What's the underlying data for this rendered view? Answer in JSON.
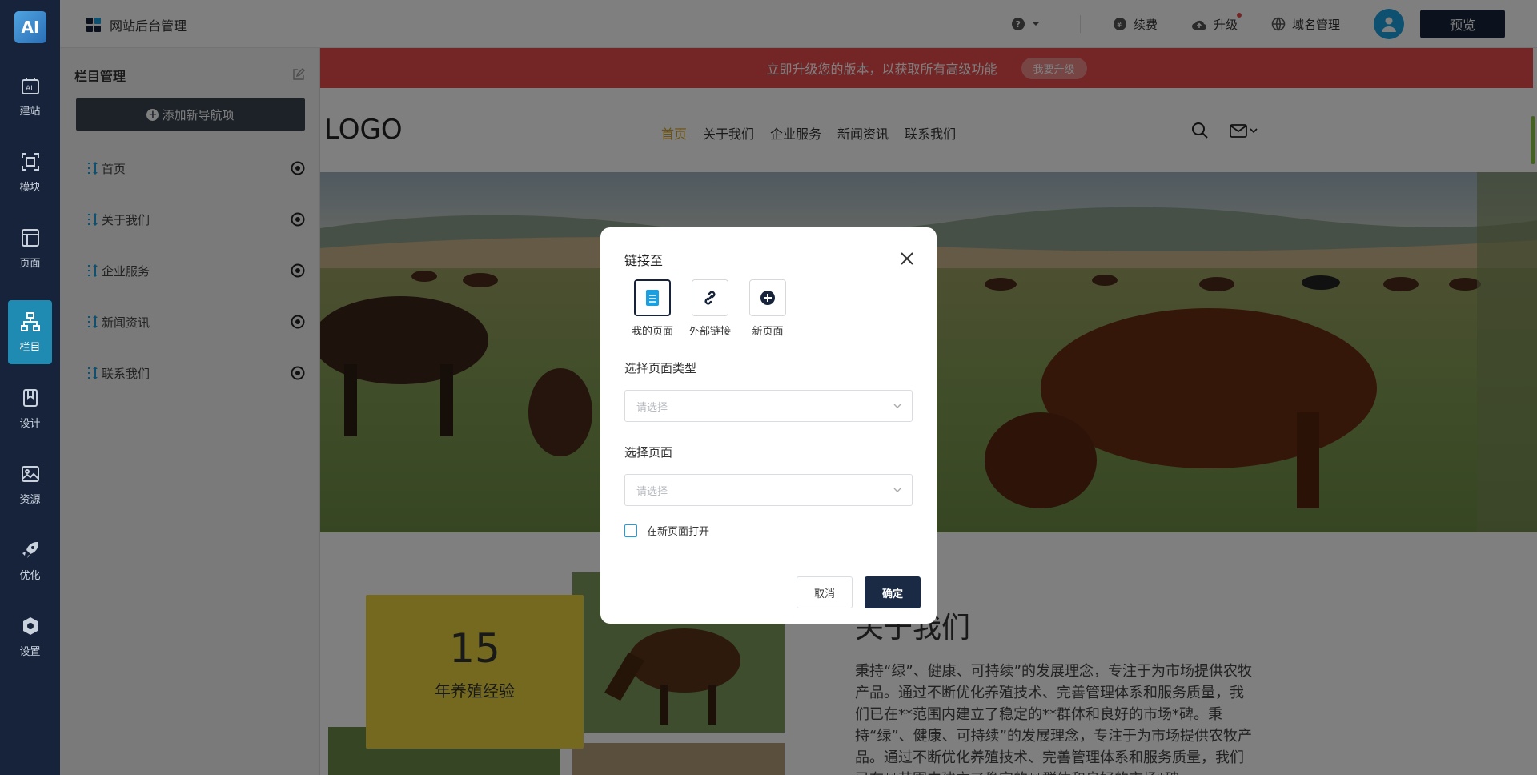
{
  "rail": {
    "logo": "AI",
    "items": [
      {
        "label": "建站",
        "icon": "ai-build-icon"
      },
      {
        "label": "模块",
        "icon": "module-icon"
      },
      {
        "label": "页面",
        "icon": "page-icon"
      },
      {
        "label": "栏目",
        "icon": "sitemap-icon"
      },
      {
        "label": "设计",
        "icon": "design-icon"
      },
      {
        "label": "资源",
        "icon": "image-icon"
      },
      {
        "label": "优化",
        "icon": "rocket-icon"
      },
      {
        "label": "设置",
        "icon": "gear-icon"
      }
    ],
    "active_index": 3
  },
  "header": {
    "title": "网站后台管理",
    "renew": "续费",
    "upgrade": "升级",
    "domain": "域名管理",
    "preview": "预览"
  },
  "panel": {
    "title": "栏目管理",
    "add_button": "添加新导航项",
    "items": [
      "首页",
      "关于我们",
      "企业服务",
      "新闻资讯",
      "联系我们"
    ]
  },
  "site": {
    "promo_text": "立即升级您的版本，以获取所有高级功能",
    "promo_button": "我要升级",
    "logo": "LOGO",
    "nav": [
      "首页",
      "关于我们",
      "企业服务",
      "新闻资讯",
      "联系我们"
    ],
    "stat_number": "15",
    "stat_label": "年养殖经验",
    "about_title": "关于我们",
    "about_text": "秉持“绿”、健康、可持续”的发展理念，专注于为市场提供农牧产品。通过不断优化养殖技术、完善管理体系和服务质量，我们已在**范围内建立了稳定的**群体和良好的市场*碑。秉持“绿”、健康、可持续”的发展理念，专注于为市场提供农牧产品。通过不断优化养殖技术、完善管理体系和服务质量，我们已在**范围内建立了稳定的**群体和良好的市场*碑。"
  },
  "modal": {
    "title": "链接至",
    "options": [
      {
        "label": "我的页面",
        "icon": "document-icon"
      },
      {
        "label": "外部链接",
        "icon": "link-icon"
      },
      {
        "label": "新页面",
        "icon": "plus-circle-icon"
      }
    ],
    "selected_option": 0,
    "page_type_label": "选择页面类型",
    "page_type_placeholder": "请选择",
    "page_label": "选择页面",
    "page_placeholder": "请选择",
    "new_window_label": "在新页面打开",
    "new_window_checked": false,
    "cancel": "取消",
    "confirm": "确定"
  },
  "colors": {
    "rail_bg": "#16233a",
    "active_rail": "#1f8bb3",
    "promo_bg": "#e84c4f",
    "nav_active": "#d8a51e",
    "stat_card": "#e8d33f"
  }
}
